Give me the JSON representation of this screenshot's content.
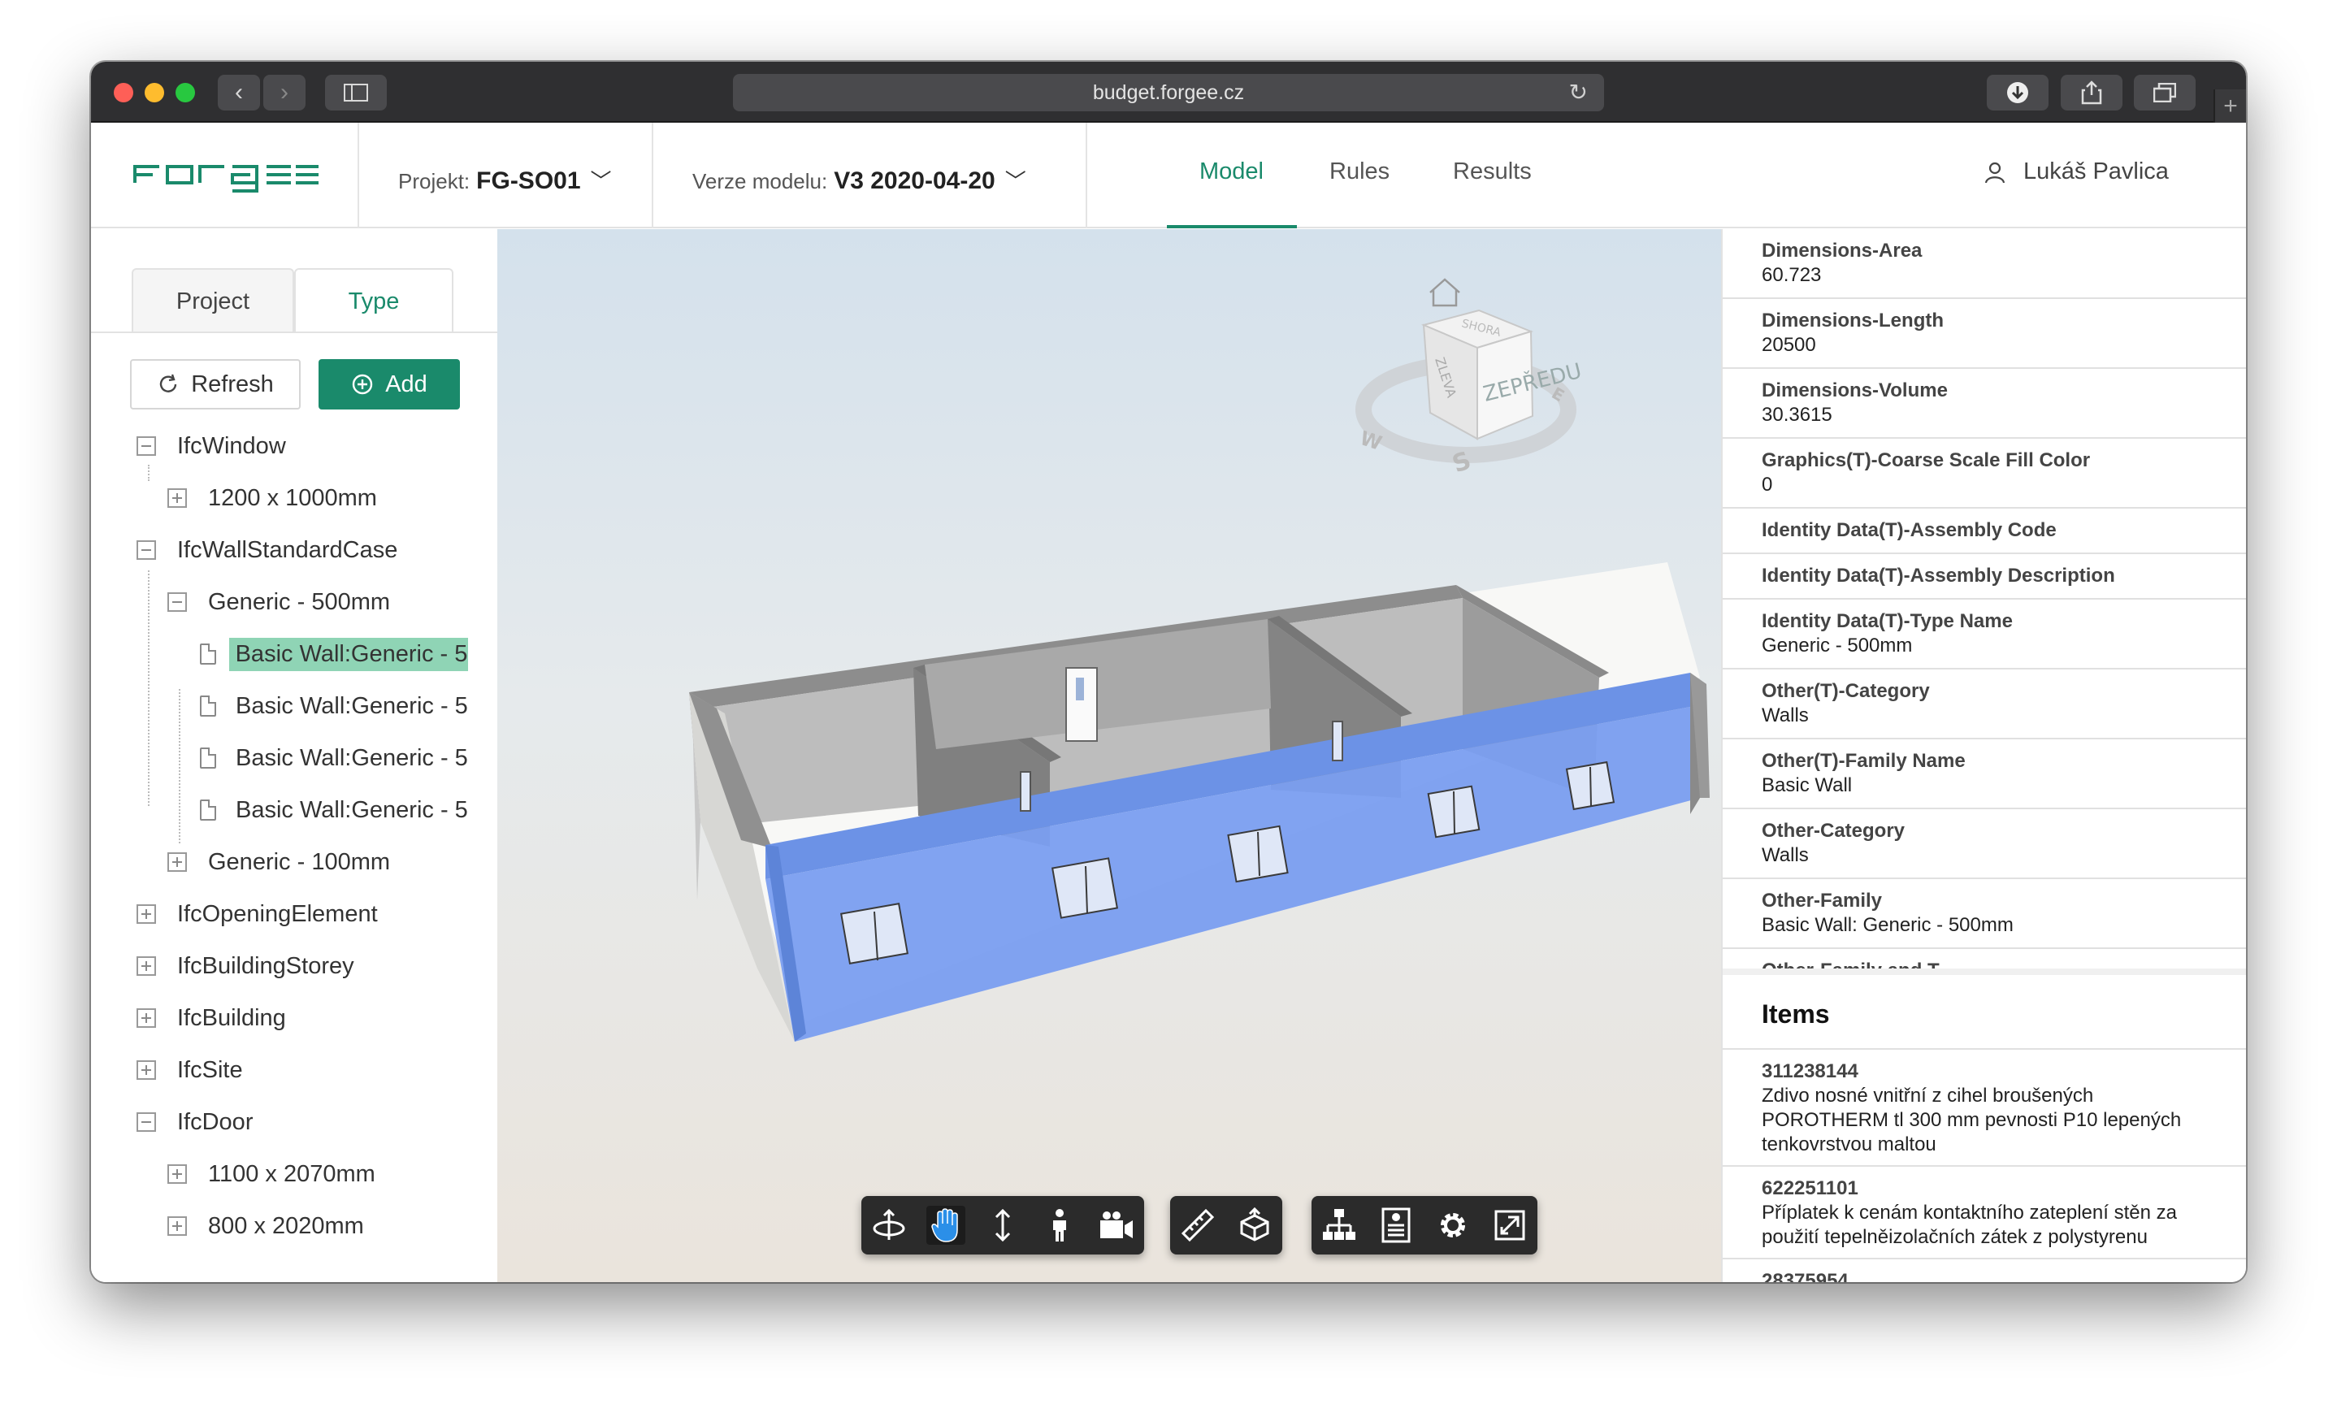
{
  "browser": {
    "url": "budget.forgee.cz"
  },
  "header": {
    "logo_text": "FORGEE",
    "project_label": "Projekt:",
    "project_value": "FG-SO01",
    "version_label": "Verze modelu:",
    "version_value": "V3 2020-04-20",
    "nav": [
      {
        "label": "Model",
        "active": true
      },
      {
        "label": "Rules",
        "active": false
      },
      {
        "label": "Results",
        "active": false
      }
    ],
    "user_name": "Lukáš Pavlica",
    "accent_color": "#1a8a6b"
  },
  "sidebar": {
    "tabs": [
      {
        "label": "Project",
        "active": false
      },
      {
        "label": "Type",
        "active": true
      }
    ],
    "refresh_label": "Refresh",
    "add_label": "Add",
    "tree": [
      {
        "label": "IfcWindow",
        "state": "expanded",
        "level": 0
      },
      {
        "label": "1200 x 1000mm",
        "state": "collapsed",
        "level": 1
      },
      {
        "label": "IfcWallStandardCase",
        "state": "expanded",
        "level": 0
      },
      {
        "label": "Generic - 500mm",
        "state": "expanded",
        "level": 1
      },
      {
        "label": "Basic Wall:Generic - 5",
        "state": "leaf",
        "level": 2,
        "selected": true
      },
      {
        "label": "Basic Wall:Generic - 5",
        "state": "leaf",
        "level": 2
      },
      {
        "label": "Basic Wall:Generic - 5",
        "state": "leaf",
        "level": 2
      },
      {
        "label": "Basic Wall:Generic - 5",
        "state": "leaf",
        "level": 2
      },
      {
        "label": "Generic - 100mm",
        "state": "collapsed",
        "level": 1
      },
      {
        "label": "IfcOpeningElement",
        "state": "collapsed",
        "level": 0
      },
      {
        "label": "IfcBuildingStorey",
        "state": "collapsed",
        "level": 0
      },
      {
        "label": "IfcBuilding",
        "state": "collapsed",
        "level": 0
      },
      {
        "label": "IfcSite",
        "state": "collapsed",
        "level": 0
      },
      {
        "label": "IfcDoor",
        "state": "expanded",
        "level": 0
      },
      {
        "label": "1100 x 2070mm",
        "state": "collapsed",
        "level": 1
      },
      {
        "label": "800 x 2020mm",
        "state": "collapsed",
        "level": 1
      }
    ]
  },
  "viewer": {
    "viewcube_front": "ZEPŘEDU",
    "viewcube_left": "ZLEVA",
    "viewcube_top": "SHORA",
    "compass": {
      "w": "W",
      "s": "S",
      "e": "E"
    },
    "toolbar": [
      [
        "orbit-icon",
        "pan-icon",
        "zoom-icon",
        "first-person-icon",
        "camera-icon"
      ],
      [
        "measure-icon",
        "section-icon"
      ],
      [
        "model-tree-icon",
        "properties-icon",
        "settings-icon",
        "fullscreen-icon"
      ]
    ]
  },
  "properties": [
    {
      "name": "Dimensions-Area",
      "value": "60.723"
    },
    {
      "name": "Dimensions-Length",
      "value": "20500"
    },
    {
      "name": "Dimensions-Volume",
      "value": "30.3615"
    },
    {
      "name": "Graphics(T)-Coarse Scale Fill Color",
      "value": "0"
    },
    {
      "name": "Identity Data(T)-Assembly Code",
      "value": ""
    },
    {
      "name": "Identity Data(T)-Assembly Description",
      "value": ""
    },
    {
      "name": "Identity Data(T)-Type Name",
      "value": "Generic - 500mm"
    },
    {
      "name": "Other(T)-Category",
      "value": "Walls"
    },
    {
      "name": "Other(T)-Family Name",
      "value": "Basic Wall"
    },
    {
      "name": "Other-Category",
      "value": "Walls"
    },
    {
      "name": "Other-Family",
      "value": "Basic Wall: Generic - 500mm"
    },
    {
      "name": "Other-Family and T",
      "value": ""
    }
  ],
  "items": {
    "title": "Items",
    "list": [
      {
        "code": "311238144",
        "description": "Zdivo nosné vnitřní z cihel broušených POROTHERM tl 300 mm pevnosti P10 lepených tenkovrstvou maltou"
      },
      {
        "code": "622251101",
        "description": "Příplatek k cenám kontaktního zateplení stěn za použití tepelněizolačních zátek z polystyrenu"
      },
      {
        "code": "28375954",
        "description": ""
      }
    ]
  }
}
